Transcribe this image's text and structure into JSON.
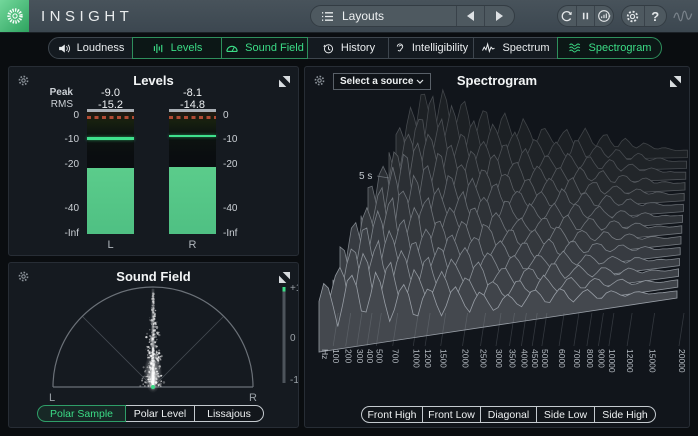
{
  "window": {
    "title": "INSIGHT"
  },
  "topbar": {
    "layouts_label": "Layouts",
    "help_label": "?",
    "icons": [
      "layout-list-icon",
      "prev-arrow-icon",
      "next-arrow-icon",
      "reset-icon",
      "pause-icon",
      "meter-reset-icon",
      "gear-icon",
      "help-icon",
      "izotope-squiggle-icon"
    ]
  },
  "tabs": [
    {
      "label": "Loudness",
      "icon": "loudness",
      "active": false
    },
    {
      "label": "Levels",
      "icon": "levels",
      "active": true
    },
    {
      "label": "Sound Field",
      "icon": "sound-field",
      "active": true
    },
    {
      "label": "History",
      "icon": "history",
      "active": false
    },
    {
      "label": "Intelligibility",
      "icon": "intelligibility",
      "active": false
    },
    {
      "label": "Spectrum",
      "icon": "spectrum",
      "active": false
    },
    {
      "label": "Spectrogram",
      "icon": "spectrogram",
      "active": true
    }
  ],
  "levels_panel": {
    "title": "Levels",
    "peak_label": "Peak",
    "rms_label": "RMS",
    "scale_labels": [
      "0",
      "-10",
      "-20",
      "-40",
      "-Inf"
    ],
    "channels": [
      {
        "name": "L",
        "peak": "-9.0",
        "rms": "-15.2",
        "peak_db": -9.0,
        "rms_db": -15.2
      },
      {
        "name": "R",
        "peak": "-8.1",
        "rms": "-14.8",
        "peak_db": -8.1,
        "rms_db": -14.8
      }
    ]
  },
  "sound_field_panel": {
    "title": "Sound Field",
    "left_label": "L",
    "right_label": "R",
    "correlation_labels": [
      "+1",
      "0",
      "-1"
    ],
    "buttons": [
      {
        "label": "Polar Sample",
        "active": true
      },
      {
        "label": "Polar Level",
        "active": false
      },
      {
        "label": "Lissajous",
        "active": false
      }
    ]
  },
  "spectrogram_panel": {
    "title": "Spectrogram",
    "source_placeholder": "Select a source",
    "time_marker": "5 s",
    "freq_unit": "Hz",
    "freq_labels": [
      100,
      200,
      300,
      400,
      500,
      700,
      1000,
      1200,
      1500,
      2000,
      2500,
      3000,
      3500,
      4000,
      4500,
      5000,
      6000,
      7000,
      8000,
      9000,
      10000,
      12000,
      15000,
      20000
    ],
    "buttons": [
      {
        "label": "Front High",
        "active": false
      },
      {
        "label": "Front Low",
        "active": false
      },
      {
        "label": "Diagonal",
        "active": false
      },
      {
        "label": "Side Low",
        "active": false
      },
      {
        "label": "Side High",
        "active": false
      }
    ]
  },
  "colors": {
    "accent_green": "#3bdc86",
    "meter_green": "#57c786",
    "clip_red": "#b04a33",
    "topbar_bg": "#424d56",
    "panel_bg": "#151a20"
  }
}
